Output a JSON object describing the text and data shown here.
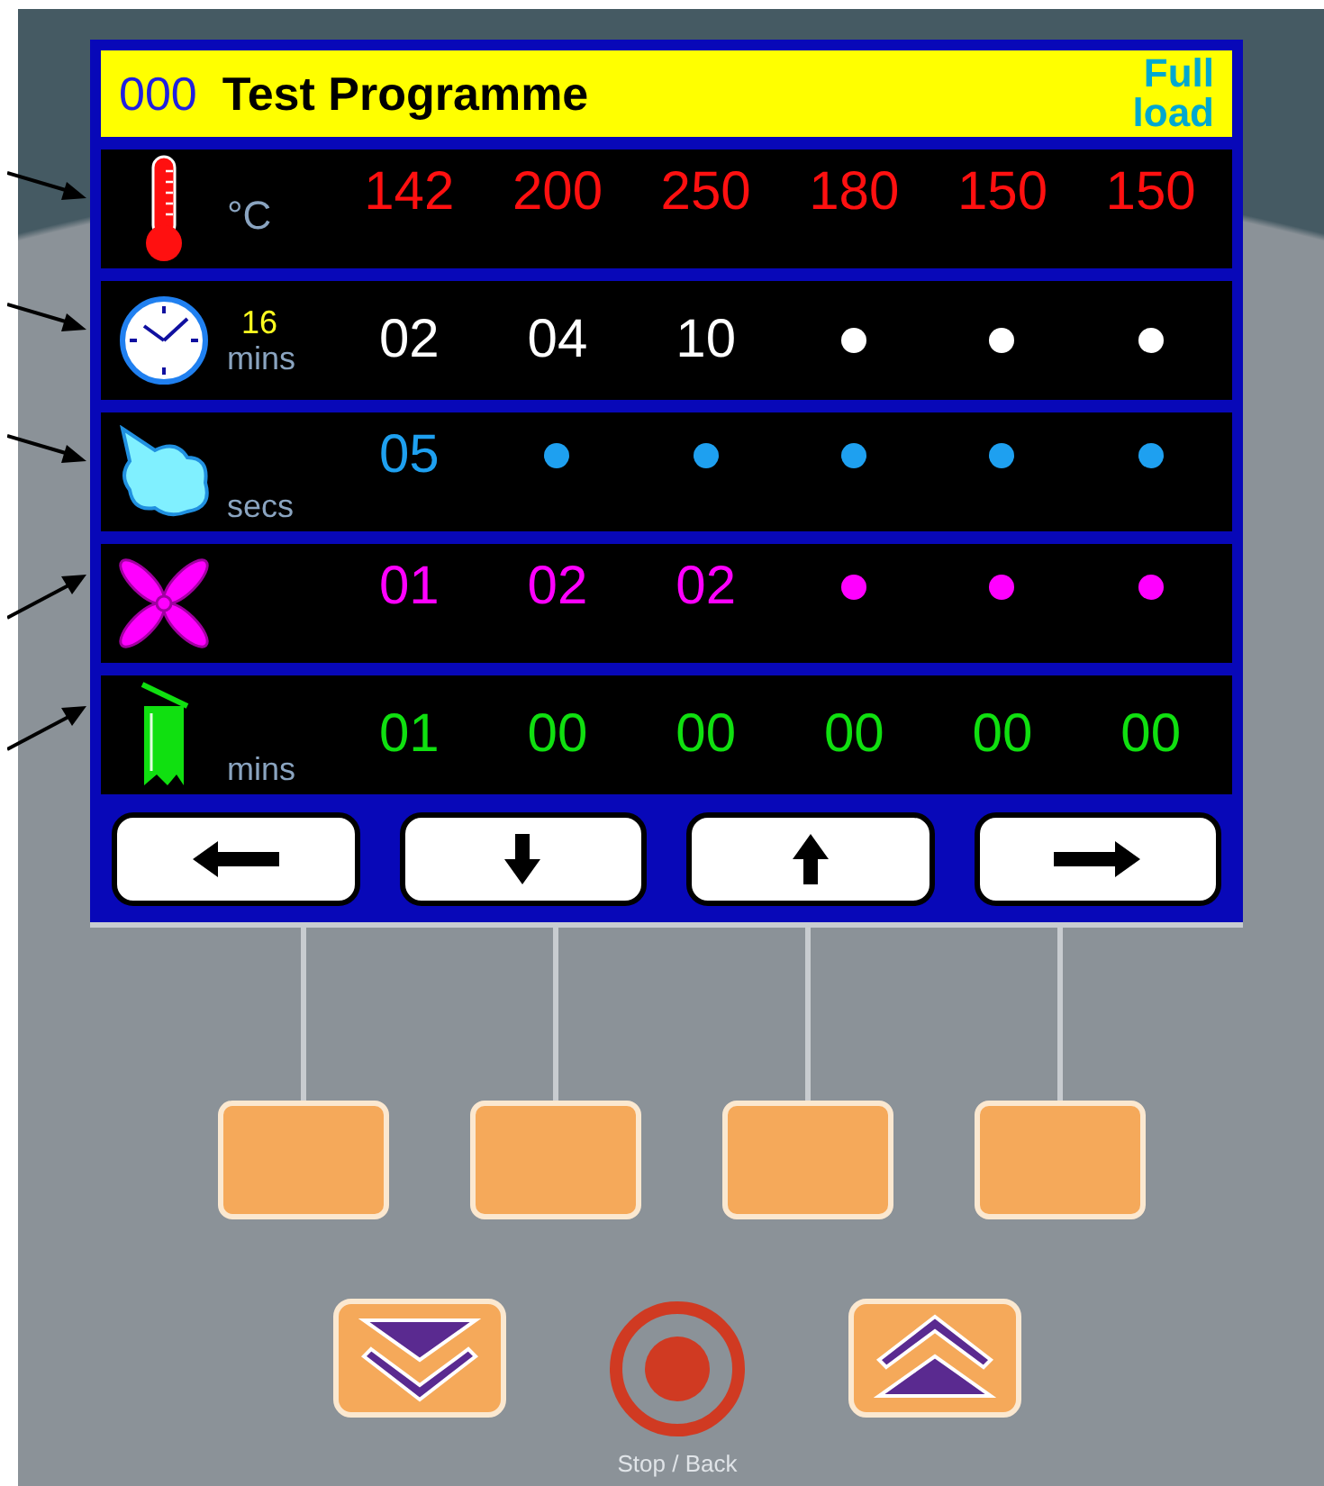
{
  "screen": {
    "program_number": "000",
    "program_name": "Test Programme",
    "load": "Full load",
    "rows": [
      {
        "kind": "temperature",
        "unit": "°C",
        "color": "#ff1010",
        "cells": [
          {
            "kind": "value",
            "text": "142"
          },
          {
            "kind": "value",
            "text": "200"
          },
          {
            "kind": "value",
            "text": "250"
          },
          {
            "kind": "value",
            "text": "180"
          },
          {
            "kind": "value",
            "text": "150"
          },
          {
            "kind": "value",
            "text": "150"
          }
        ]
      },
      {
        "kind": "time",
        "total": "16",
        "unit": "mins",
        "color": "#ffffff",
        "cells": [
          {
            "kind": "value",
            "text": "02"
          },
          {
            "kind": "value",
            "text": "04"
          },
          {
            "kind": "value",
            "text": "10"
          },
          {
            "kind": "dot"
          },
          {
            "kind": "dot"
          },
          {
            "kind": "dot"
          }
        ]
      },
      {
        "kind": "steam",
        "unit": "secs",
        "color": "#1ea0f0",
        "cells": [
          {
            "kind": "value",
            "text": "05"
          },
          {
            "kind": "dot"
          },
          {
            "kind": "dot"
          },
          {
            "kind": "dot"
          },
          {
            "kind": "dot"
          },
          {
            "kind": "dot"
          }
        ]
      },
      {
        "kind": "fan",
        "color": "#ff00ff",
        "cells": [
          {
            "kind": "value",
            "text": "01"
          },
          {
            "kind": "value",
            "text": "02"
          },
          {
            "kind": "value",
            "text": "02"
          },
          {
            "kind": "dot"
          },
          {
            "kind": "dot"
          },
          {
            "kind": "dot"
          }
        ]
      },
      {
        "kind": "vent",
        "unit": "mins",
        "color": "#10e010",
        "cells": [
          {
            "kind": "value",
            "text": "01"
          },
          {
            "kind": "value",
            "text": "00"
          },
          {
            "kind": "value",
            "text": "00"
          },
          {
            "kind": "value",
            "text": "00"
          },
          {
            "kind": "value",
            "text": "00"
          },
          {
            "kind": "value",
            "text": "00"
          }
        ]
      }
    ],
    "softkeys": [
      {
        "kind": "left"
      },
      {
        "kind": "down"
      },
      {
        "kind": "up"
      },
      {
        "kind": "right"
      }
    ]
  },
  "stop_label": "Stop / Back"
}
